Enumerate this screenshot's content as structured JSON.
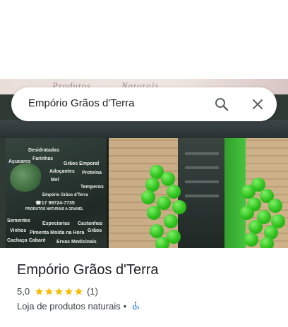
{
  "search": {
    "query": "Empório Grãos d'Terra",
    "search_icon": "search-icon",
    "close_icon": "close-icon"
  },
  "photo": {
    "sign_words": [
      "Produtos",
      "Naturais"
    ],
    "window_lines": [
      "Desidratadas",
      "Açucares",
      "Farinhas",
      "Adoçantes",
      "Grãos Emporal",
      "Proteína",
      "Mel",
      "Temperos",
      "Empório Grãos d'Terra",
      "☎17 99724-7735",
      "PRODUTOS NATURAIS A GRANEL",
      "Sementes",
      "Especiarias",
      "Castanhas",
      "Vinhos",
      "Pimenta Moída na Hora",
      "Grãos",
      "Cachaça Cabaré",
      "Ervas Medicinais"
    ]
  },
  "place": {
    "name": "Empório Grãos d'Terra",
    "rating": "5,0",
    "stars": 5,
    "review_count": "(1)",
    "category": "Loja de produtos naturais",
    "separator": "•",
    "accessibility_icon": "wheelchair-accessible-icon"
  },
  "colors": {
    "star": "#fbbc04",
    "accessibility": "#1a73e8",
    "text_primary": "#202124",
    "text_secondary": "#3c4043"
  }
}
